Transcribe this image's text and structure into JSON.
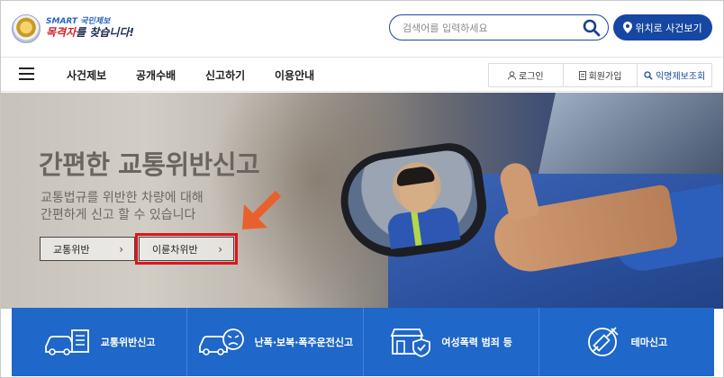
{
  "header": {
    "logo": {
      "line1": "SMART 국민제보",
      "line2_accent": "목격자",
      "line2_rest": "를 찾습니다!"
    },
    "search": {
      "placeholder": "검색어를 입력하세요"
    },
    "location_button": "위치로 사건보기"
  },
  "nav": {
    "menu": [
      "사건제보",
      "공개수배",
      "신고하기",
      "이용안내"
    ],
    "util": [
      "로그인",
      "회원가입",
      "익명제보조회"
    ]
  },
  "hero": {
    "title": "간편한 교통위반신고",
    "subtitle_line1": "교통법규를 위반한 차량에 대해",
    "subtitle_line2": "간편하게 신고 할 수 있습니다",
    "buttons": [
      {
        "label": "교통위반",
        "chevron": "›"
      },
      {
        "label": "이륜차위반",
        "chevron": "›"
      }
    ]
  },
  "quick_menu": [
    {
      "label": "교통위반신고",
      "icon": "car-document-icon"
    },
    {
      "label": "난폭·보복·폭주운전신고",
      "icon": "angry-car-icon"
    },
    {
      "label": "여성폭력 범죄 등",
      "icon": "shop-shield-icon"
    },
    {
      "label": "테마신고",
      "icon": "syringe-icon"
    }
  ],
  "colors": {
    "brand_blue": "#1647a2",
    "quick_blue": "#1f67c8",
    "highlight_red": "#e0141e",
    "arrow_orange": "#e8612c"
  }
}
